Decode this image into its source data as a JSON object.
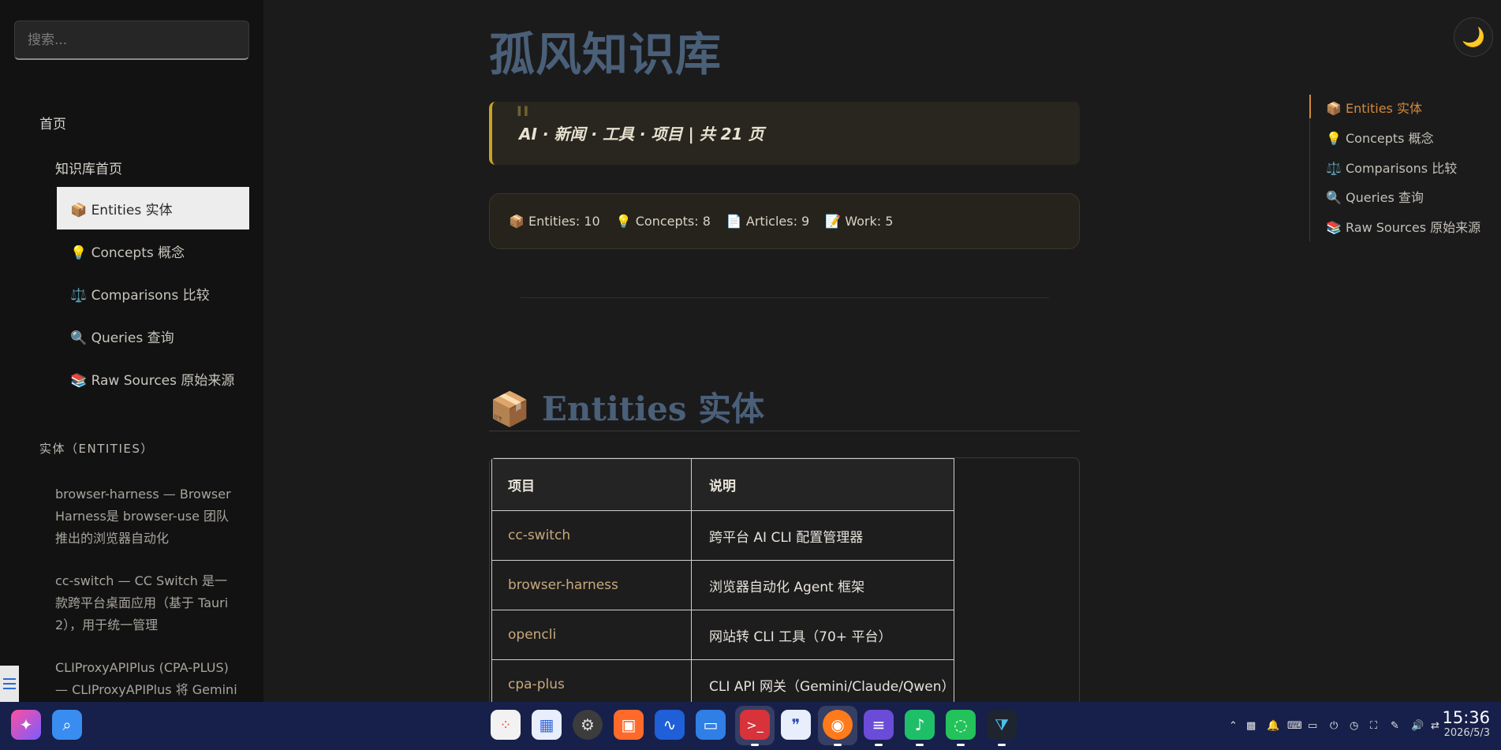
{
  "search": {
    "placeholder": "搜索..."
  },
  "sidebar": {
    "home": "首页",
    "kb_home": "知识库首页",
    "items": [
      {
        "label": "📦 Entities 实体"
      },
      {
        "label": "💡 Concepts 概念"
      },
      {
        "label": "⚖️ Comparisons 比较"
      },
      {
        "label": "🔍 Queries 查询"
      },
      {
        "label": "📚 Raw Sources 原始来源"
      }
    ],
    "entities_section": "实体（ENTITIES）",
    "entity_links": [
      "browser-harness — Browser Harness是 browser-use 团队推出的浏览器自动化",
      "cc-switch — CC Switch 是一款跨平台桌面应用（基于 Tauri 2），用于统一管理",
      "CLIProxyAPIPlus (CPA-PLUS) — CLIProxyAPIPlus 将 Gemini"
    ]
  },
  "main": {
    "title": "孤风知识库",
    "quote_mark": "\"",
    "subtitle": "AI · 新闻 · 工具 · 项目 | 共 21 页",
    "stats": [
      "📦 Entities: 10",
      "💡 Concepts: 8",
      "📄 Articles: 9",
      "📝 Work: 5"
    ],
    "section_heading": "📦 Entities 实体",
    "table": {
      "headers": [
        "项目",
        "说明"
      ],
      "rows": [
        [
          "cc-switch",
          "跨平台 AI CLI 配置管理器"
        ],
        [
          "browser-harness",
          "浏览器自动化 Agent 框架"
        ],
        [
          "opencli",
          "网站转 CLI 工具（70+ 平台）"
        ],
        [
          "cpa-plus",
          "CLI API 网关（Gemini/Claude/Qwen）"
        ]
      ]
    }
  },
  "toc": [
    "📦 Entities 实体",
    "💡 Concepts 概念",
    "⚖️ Comparisons 比较",
    "🔍 Queries 查询",
    "📚 Raw Sources 原始来源"
  ],
  "theme_toggle": "🌙",
  "taskbar": {
    "time": "15:36",
    "date": "2026/5/3",
    "icons": [
      "ai-assistant-icon",
      "search-icon",
      "launcher-icon",
      "multitask-icon",
      "settings-icon",
      "app-store-icon",
      "system-monitor-icon",
      "file-manager-icon",
      "terminal-icon",
      "quote-app-icon",
      "firefox-icon",
      "notes-icon",
      "music-icon",
      "wechat-icon",
      "vscode-icon"
    ]
  },
  "colors": {
    "accent": "#d38a3a",
    "title": "#4a5f78",
    "taskbar": "#16204a"
  }
}
